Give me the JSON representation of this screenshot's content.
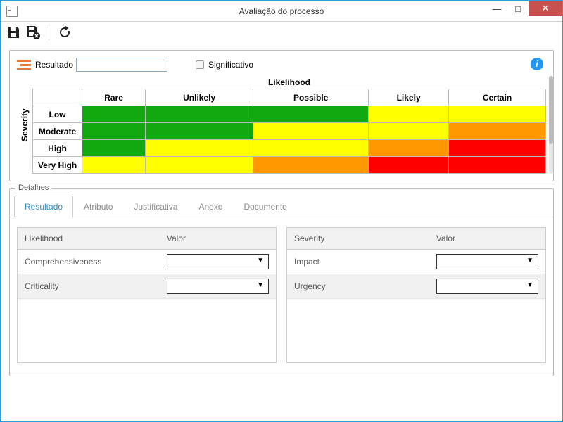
{
  "window": {
    "title": "Avaliação do processo"
  },
  "toolbar": {
    "resultado_label": "Resultado",
    "resultado_value": "",
    "significativo_label": "Significativo",
    "significativo_checked": false
  },
  "matrix": {
    "likelihood_label": "Likelihood",
    "severity_label": "Severity",
    "columns": [
      "Rare",
      "Unlikely",
      "Possible",
      "Likely",
      "Certain"
    ],
    "rows": [
      "Low",
      "Moderate",
      "High",
      "Very High"
    ],
    "colors": [
      [
        "green",
        "green",
        "green",
        "yellow",
        "yellow"
      ],
      [
        "green",
        "green",
        "yellow",
        "yellow",
        "orange"
      ],
      [
        "green",
        "yellow",
        "yellow",
        "orange",
        "red"
      ],
      [
        "yellow",
        "yellow",
        "orange",
        "red",
        "red"
      ]
    ]
  },
  "details": {
    "legend": "Detalhes",
    "tabs": [
      {
        "id": "resultado",
        "label": "Resultado",
        "active": true
      },
      {
        "id": "atributo",
        "label": "Atributo",
        "active": false
      },
      {
        "id": "justificativa",
        "label": "Justificativa",
        "active": false
      },
      {
        "id": "anexo",
        "label": "Anexo",
        "active": false
      },
      {
        "id": "documento",
        "label": "Documento",
        "active": false
      }
    ],
    "likelihood_panel": {
      "header_name": "Likelihood",
      "header_value": "Valor",
      "rows": [
        {
          "name": "Comprehensiveness",
          "value": ""
        },
        {
          "name": "Criticality",
          "value": ""
        }
      ]
    },
    "severity_panel": {
      "header_name": "Severity",
      "header_value": "Valor",
      "rows": [
        {
          "name": "Impact",
          "value": ""
        },
        {
          "name": "Urgency",
          "value": ""
        }
      ]
    }
  }
}
